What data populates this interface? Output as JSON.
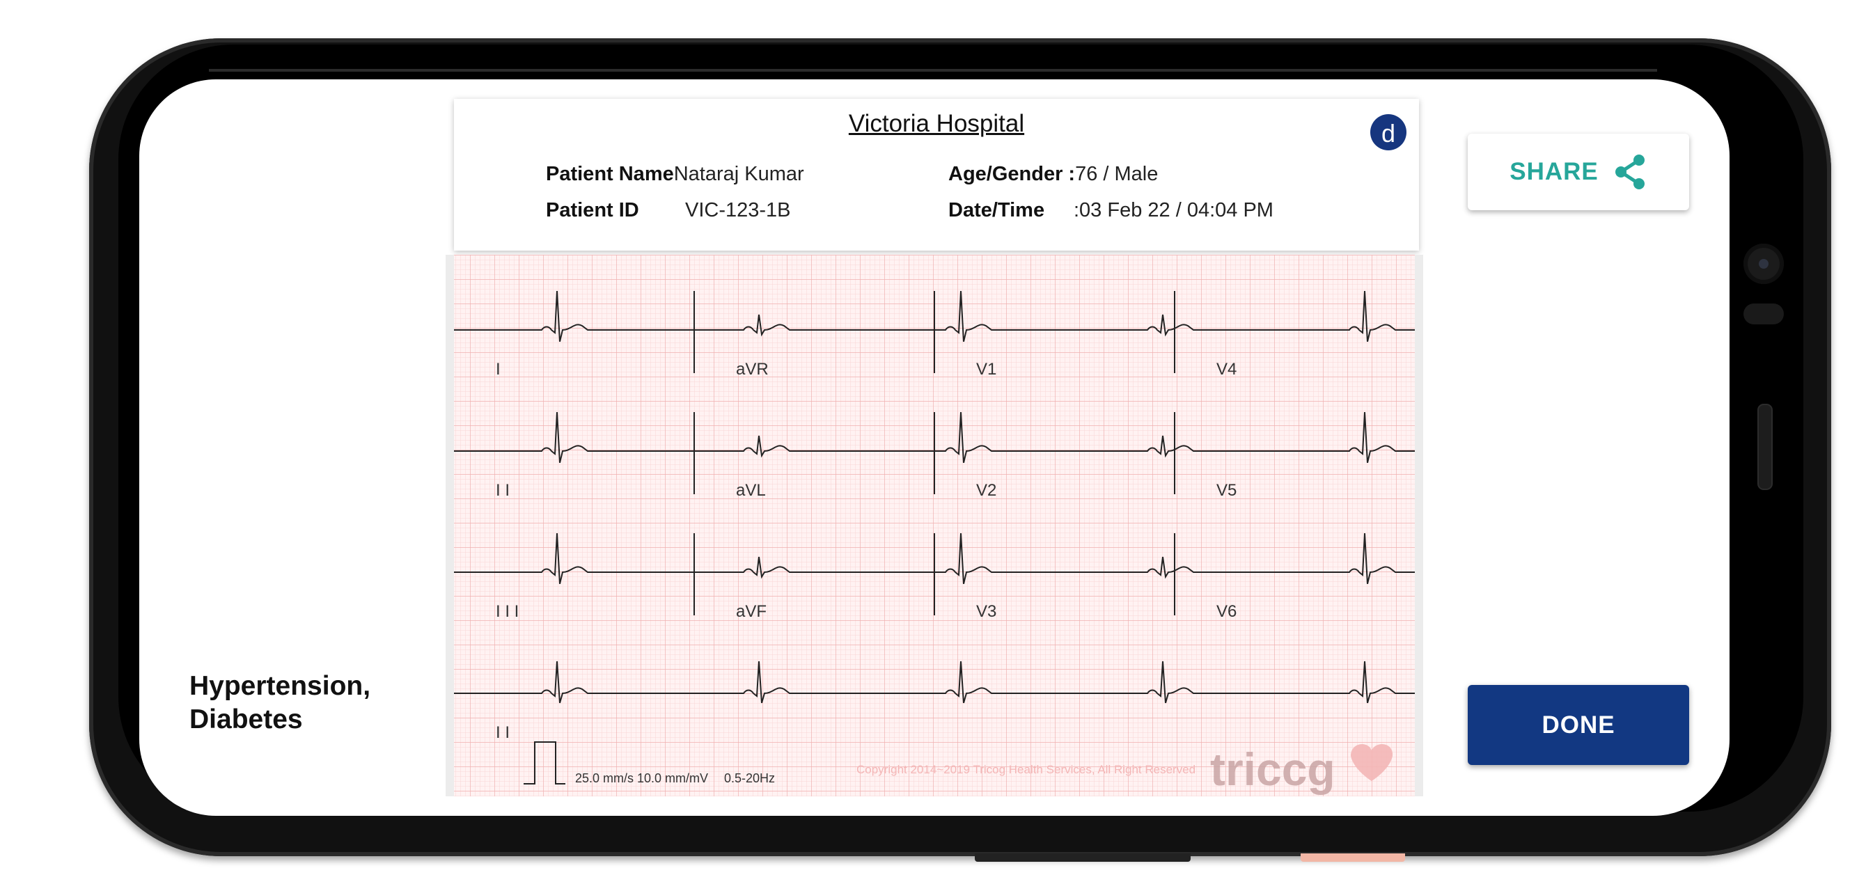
{
  "report": {
    "hospital": "Victoria Hospital",
    "logo_letter": "d",
    "patient_name_label": "Patient Name",
    "patient_name": "Nataraj Kumar",
    "patient_id_label": "Patient ID",
    "patient_id": "VIC-123-1B",
    "age_gender_label": "Age/Gender :",
    "age_gender": "76 / Male",
    "datetime_label": "Date/Time",
    "datetime": ":03 Feb 22  / 04:04 PM"
  },
  "ecg": {
    "leads": [
      [
        "I",
        "aVR",
        "V1",
        "V4"
      ],
      [
        "I I",
        "aVL",
        "V2",
        "V5"
      ],
      [
        "I I I",
        "aVF",
        "V3",
        "V6"
      ],
      [
        "I I"
      ]
    ],
    "settings": "25.0 mm/s 10.0 mm/mV",
    "filter": "0.5-20Hz",
    "copyright": "Copyright 2014~2019 Tricog Health Services, All Right Reserved",
    "brand": "triccg"
  },
  "diagnosis": "Hypertension, Diabetes",
  "actions": {
    "share_label": "SHARE",
    "done_label": "DONE"
  },
  "colors": {
    "done_bg": "#123882",
    "share_fg": "#26a69a",
    "grid_minor": "#f9d3d3",
    "grid_major": "#f2a9a9"
  }
}
